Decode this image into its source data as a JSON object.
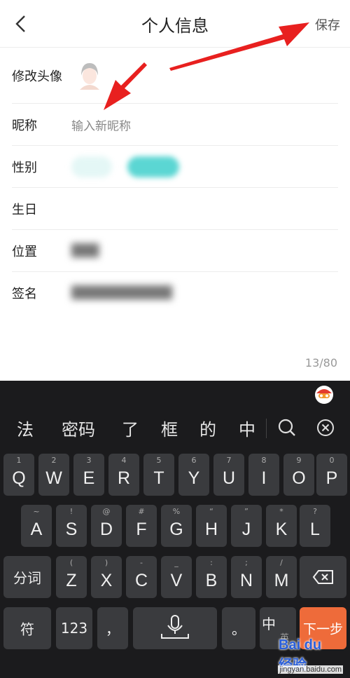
{
  "header": {
    "title": "个人信息",
    "save_label": "保存"
  },
  "form": {
    "avatar_label": "修改头像",
    "nickname_label": "昵称",
    "nickname_placeholder": "输入新昵称",
    "gender_label": "性别",
    "birthday_label": "生日",
    "location_label": "位置",
    "location_value": "███",
    "signature_label": "签名",
    "signature_value": "███████████",
    "counter": "13/80"
  },
  "keyboard": {
    "candidates": [
      "法",
      "密码",
      "了",
      "框",
      "的",
      "中"
    ],
    "row1": [
      {
        "main": "Q",
        "sub": "1"
      },
      {
        "main": "W",
        "sub": "2"
      },
      {
        "main": "E",
        "sub": "3"
      },
      {
        "main": "R",
        "sub": "4"
      },
      {
        "main": "T",
        "sub": "5"
      },
      {
        "main": "Y",
        "sub": "6"
      },
      {
        "main": "U",
        "sub": "7"
      },
      {
        "main": "I",
        "sub": "8"
      },
      {
        "main": "O",
        "sub": "9"
      },
      {
        "main": "P",
        "sub": "0"
      }
    ],
    "row2": [
      {
        "main": "A",
        "sub": "~"
      },
      {
        "main": "S",
        "sub": "!"
      },
      {
        "main": "D",
        "sub": "@"
      },
      {
        "main": "F",
        "sub": "#"
      },
      {
        "main": "G",
        "sub": "%"
      },
      {
        "main": "H",
        "sub": "“"
      },
      {
        "main": "J",
        "sub": "”"
      },
      {
        "main": "K",
        "sub": "*"
      },
      {
        "main": "L",
        "sub": "?"
      }
    ],
    "row3": [
      {
        "main": "Z",
        "sub": "("
      },
      {
        "main": "X",
        "sub": ")"
      },
      {
        "main": "C",
        "sub": "-"
      },
      {
        "main": "V",
        "sub": "_"
      },
      {
        "main": "B",
        "sub": ":"
      },
      {
        "main": "N",
        "sub": ";"
      },
      {
        "main": "M",
        "sub": "/"
      }
    ],
    "fenci_label": "分词",
    "symbol_label": "符",
    "num_label": "123",
    "comma_label": "，",
    "period_label": "。",
    "lang_main": "中",
    "lang_sub": "英",
    "next_label": "下一步",
    "icons": [
      "search-icon",
      "close-circle-icon",
      "backspace-icon",
      "microphone-icon",
      "mascot-icon",
      "back-chevron-icon"
    ]
  },
  "watermark": {
    "logo": "Bai du 经验",
    "url": "jingyan.baidu.com"
  },
  "colors": {
    "accent": "#ee6b3a",
    "arrow": "#e8201f",
    "teal": "#5bd6d3",
    "keyboard_bg": "#1b1b1d",
    "key_bg": "#3a3b3e"
  }
}
